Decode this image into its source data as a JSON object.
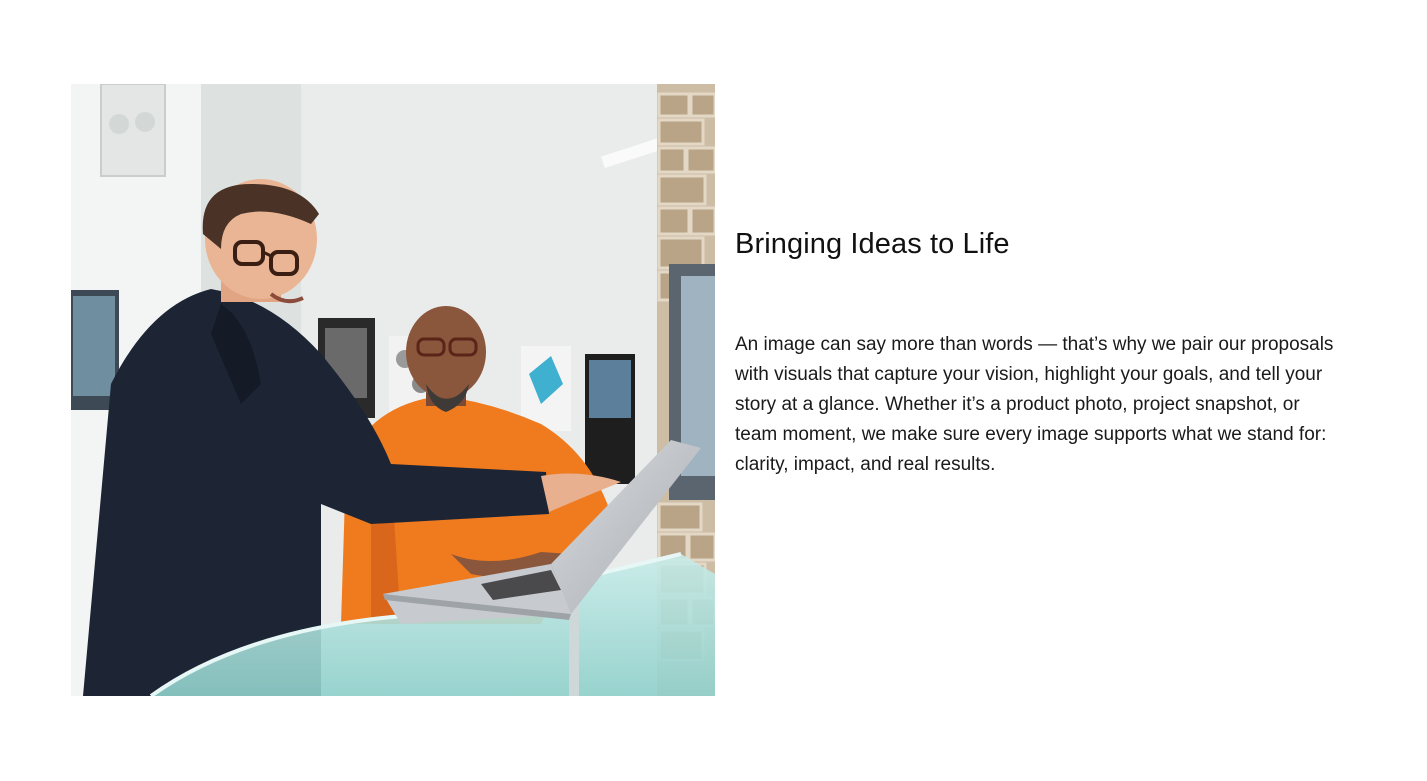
{
  "feature": {
    "image_alt": "Two men looking at a laptop screen in an office",
    "heading": "Bringing Ideas to Life",
    "paragraph": "An image can say more than words — that’s why we pair our proposals with visuals that capture your vision, highlight your goals, and tell your story at a glance. Whether it’s a product photo, project snapshot, or team moment, we make sure every image supports what we stand for: clarity, impact, and real results."
  },
  "colors": {
    "background": "#ffffff",
    "heading_text": "#111111",
    "body_text": "#1a1a1a",
    "orange_shirt": "#f07a1e",
    "dark_jacket": "#1d2535",
    "glass_table": "#a9dcd8"
  }
}
